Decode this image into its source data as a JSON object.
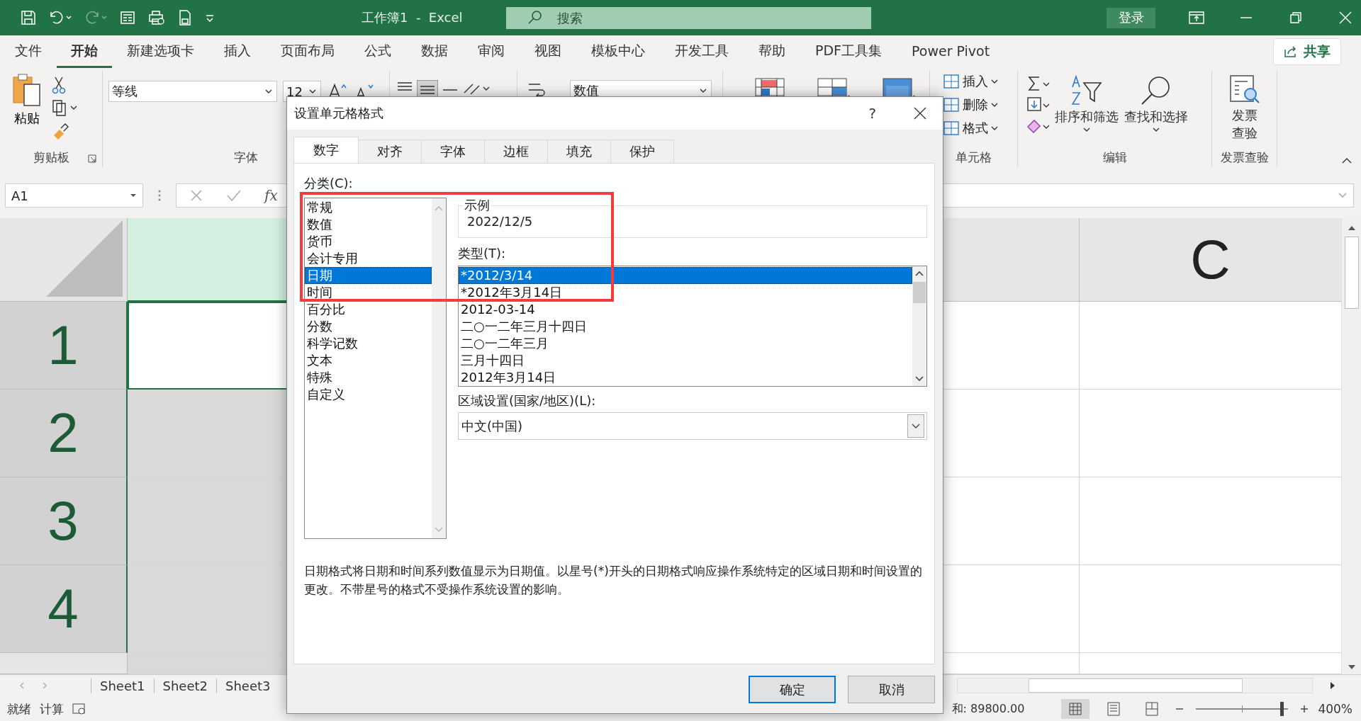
{
  "title_bar": {
    "title": "工作簿1  -  Excel",
    "search_placeholder": "搜索",
    "login": "登录"
  },
  "ribbon_tabs": [
    {
      "label": "文件",
      "selected": false
    },
    {
      "label": "开始",
      "selected": true
    },
    {
      "label": "新建选项卡",
      "selected": false
    },
    {
      "label": "插入",
      "selected": false
    },
    {
      "label": "页面布局",
      "selected": false
    },
    {
      "label": "公式",
      "selected": false
    },
    {
      "label": "数据",
      "selected": false
    },
    {
      "label": "审阅",
      "selected": false
    },
    {
      "label": "视图",
      "selected": false
    },
    {
      "label": "模板中心",
      "selected": false
    },
    {
      "label": "开发工具",
      "selected": false
    },
    {
      "label": "帮助",
      "selected": false
    },
    {
      "label": "PDF工具集",
      "selected": false
    },
    {
      "label": "Power Pivot",
      "selected": false
    }
  ],
  "share": "共享",
  "clipboard": {
    "paste": "粘贴",
    "group": "剪贴板"
  },
  "font": {
    "name": "等线",
    "size": "12",
    "group": "字体"
  },
  "number": {
    "format": "数值"
  },
  "cells": {
    "items": [
      "插入",
      "删除",
      "格式"
    ],
    "group": "单元格"
  },
  "editing": {
    "sort_filter": "排序和筛选",
    "find_select": "查找和选择",
    "group": "编辑"
  },
  "invoice": {
    "button_lines": [
      "发票",
      "查验"
    ],
    "group": "发票查验"
  },
  "formula_bar": {
    "name_box": "A1",
    "fx": "fx"
  },
  "sheet": {
    "column_a": {
      "selected": true
    },
    "column_c": "C",
    "row_headers": [
      "1",
      "2",
      "3",
      "4"
    ]
  },
  "sheet_tabs": [
    "Sheet1",
    "Sheet2",
    "Sheet3"
  ],
  "status_bar": {
    "mode": "就绪",
    "calc": "计算",
    "sum": "和: 89800.00",
    "zoom": "400%",
    "zoom_slider": {
      "level": 0.95
    }
  },
  "dialog": {
    "title": "设置单元格格式",
    "help": "?",
    "tabs": [
      {
        "label": "数字",
        "selected": true
      },
      {
        "label": "对齐",
        "selected": false
      },
      {
        "label": "字体",
        "selected": false
      },
      {
        "label": "边框",
        "selected": false
      },
      {
        "label": "填充",
        "selected": false
      },
      {
        "label": "保护",
        "selected": false
      }
    ],
    "category_label": "分类(C):",
    "categories": [
      {
        "label": "常规",
        "selected": false
      },
      {
        "label": "数值",
        "selected": false
      },
      {
        "label": "货币",
        "selected": false
      },
      {
        "label": "会计专用",
        "selected": false
      },
      {
        "label": "日期",
        "selected": true
      },
      {
        "label": "时间",
        "selected": false
      },
      {
        "label": "百分比",
        "selected": false
      },
      {
        "label": "分数",
        "selected": false
      },
      {
        "label": "科学记数",
        "selected": false
      },
      {
        "label": "文本",
        "selected": false
      },
      {
        "label": "特殊",
        "selected": false
      },
      {
        "label": "自定义",
        "selected": false
      }
    ],
    "sample_label": "示例",
    "sample_value": "2022/12/5",
    "type_label": "类型(T):",
    "types": [
      {
        "label": "*2012/3/14",
        "selected": true
      },
      {
        "label": "*2012年3月14日",
        "selected": false
      },
      {
        "label": "2012-03-14",
        "selected": false
      },
      {
        "label": "二○一二年三月十四日",
        "selected": false
      },
      {
        "label": "二○一二年三月",
        "selected": false
      },
      {
        "label": "三月十四日",
        "selected": false
      },
      {
        "label": "2012年3月14日",
        "selected": false
      }
    ],
    "locale_label": "区域设置(国家/地区)(L):",
    "locale_value": "中文(中国)",
    "description": "日期格式将日期和时间系列数值显示为日期值。以星号(*)开头的日期格式响应操作系统特定的区域日期和时间设置的更改。不带星号的格式不受操作系统设置的影响。",
    "buttons": [
      {
        "label": "确定",
        "kind": "default"
      },
      {
        "label": "取消",
        "kind": "normal"
      }
    ]
  },
  "annotation": {
    "kind": "rectangle"
  }
}
